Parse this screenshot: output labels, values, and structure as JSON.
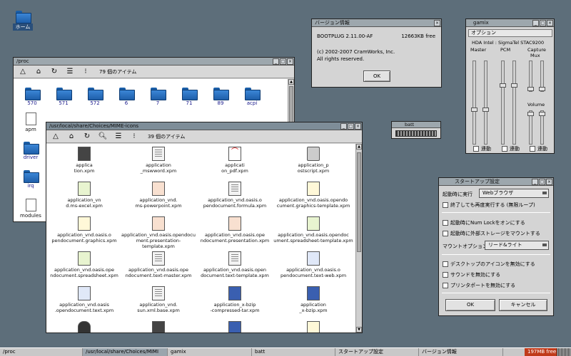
{
  "desktop": {
    "home_label": "ホーム"
  },
  "proc_window": {
    "title": "/proc",
    "count": "79 個のアイテム",
    "row1": [
      "570",
      "571",
      "572",
      "6",
      "7",
      "71",
      "89",
      "acpi"
    ],
    "left_col": [
      "apm",
      "driver",
      "irq",
      "modules"
    ]
  },
  "mime_window": {
    "title": "/usr/local/share/Choices/MIME-icons",
    "count": "39 個のアイテム",
    "items": [
      [
        "applica\ntion.xpm",
        "application\n_mswword.xpm",
        "applicati\non_pdf.xpm",
        "application_p\nostscript.xpm"
      ],
      [
        "application_vn\nd.ms-excel.xpm",
        "application_vnd.\nms-powerpoint.xpm",
        "application_vnd.oasis.o\npendocument.formula.xpm",
        "application_vnd.oasis.opendo\ncument.graphics-template.xpm"
      ],
      [
        "application_vnd.oasis.o\npendocument.graphics.xpm",
        "application_vnd.oasis.opendocu\nment.presentation-template.xpm",
        "application_vnd.oasis.ope\nndocument.presentation.xpm",
        "application_vnd.oasis.opendoc\nument.spreadsheet-template.xpm"
      ],
      [
        "application_vnd.oasis.ope\nndocument.spreadsheet.xpm",
        "application_vnd.oasis.ope\nndocument.text-master.xpm",
        "application_vnd.oasis.open\ndocument.text-template.xpm",
        "application_vnd.oasis.o\npendocument.text-web.xpm"
      ],
      [
        "application_vnd.oasis\n.opendocument.text.xpm",
        "application_vnd.\nsun.xml.base.xpm",
        "application_x-bzip\n-compressed-tar.xpm",
        "application\n_x-bzip.xpm"
      ]
    ]
  },
  "version_window": {
    "title": "バージョン情報",
    "product": "BOOTPLUG  2.11.00-AF",
    "free": "12663KB free",
    "copyright": "(c) 2002-2007 CramWorks, Inc.",
    "rights": "All rights reserved.",
    "ok": "OK"
  },
  "gamix": {
    "title": "gamix",
    "options": "オプション",
    "device": "HDA Intel : SigmaTel STAC9200",
    "master": "Master",
    "pcm": "PCM",
    "capture": "Capture",
    "mux": "Mux",
    "volume": "Volume",
    "link": "連動"
  },
  "batt": {
    "title": "batt"
  },
  "startup": {
    "title": "スタートアップ設定",
    "run_label": "起動時に実行",
    "run_value": "Webブラウザ",
    "rerun": "終了しても再度実行する (無限ループ)",
    "numlock": "起動時にNum Lockをオンにする",
    "mount": "起動時に外部ストレージをマウントする",
    "mount_opt_label": "マウントオプション",
    "mount_opt_value": "リード&ライト",
    "desk_icons": "デスクトップのアイコンを無効にする",
    "sound": "サウンドを無効にする",
    "printer": "プリンタポートを無効にする",
    "ok": "OK",
    "cancel": "キャンセル"
  },
  "taskbar": {
    "tasks": [
      "/proc",
      "/usr/local/share/Choices/MIMI",
      "gamix",
      "batt",
      "スタートアップ設定",
      "バージョン情報"
    ],
    "free": "197MB free"
  },
  "colors": {
    "desktop": "#5d6e7a",
    "folder": "#2a72c2",
    "free_badge": "#c03a1a"
  }
}
